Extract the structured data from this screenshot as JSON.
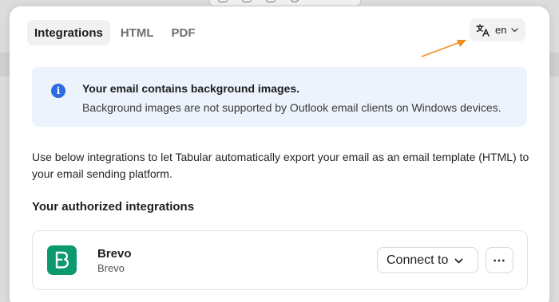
{
  "tabs": [
    {
      "label": "Integrations",
      "active": true
    },
    {
      "label": "HTML",
      "active": false
    },
    {
      "label": "PDF",
      "active": false
    }
  ],
  "language": {
    "label": "en",
    "icon": "translate-icon"
  },
  "info": {
    "title": "Your email contains background images.",
    "text": "Background images are not supported by Outlook email clients on Windows devices."
  },
  "description": "Use below integrations to let Tabular automatically export your email as an email template (HTML) to your email sending platform.",
  "section_title": "Your authorized integrations",
  "integration": {
    "name": "Brevo",
    "subtitle": "Brevo",
    "logo_letter": "B",
    "connect_label": "Connect to",
    "more_label": "⋯"
  },
  "colors": {
    "brevo_green": "#0b996e",
    "info_bg": "#edf3fd",
    "info_icon": "#2d6cdf",
    "annotation_arrow": "#f28c1b"
  }
}
